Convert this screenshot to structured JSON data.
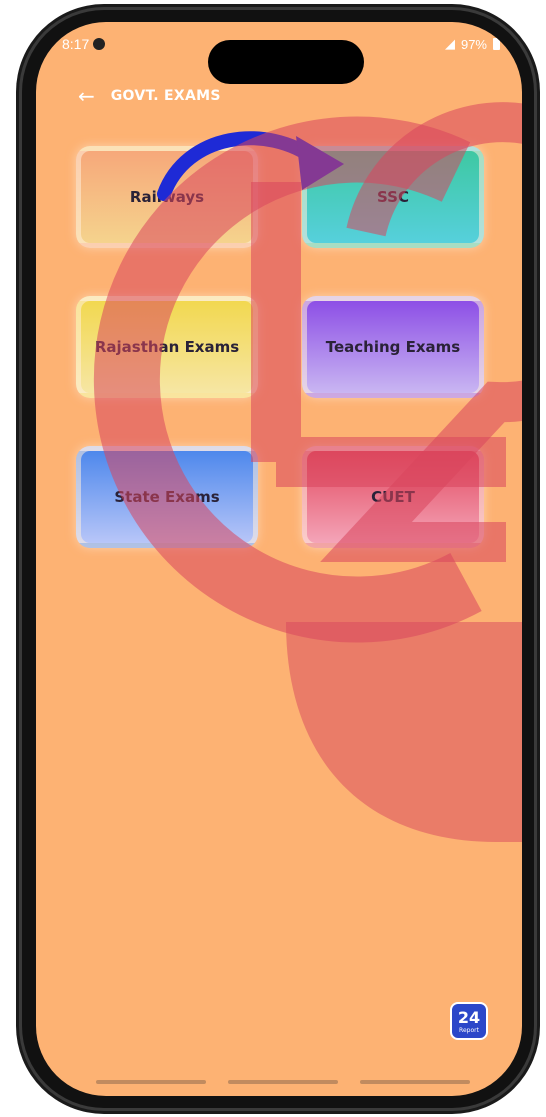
{
  "status_bar": {
    "time": "8:17",
    "battery": "97%"
  },
  "header": {
    "back_icon": "←",
    "title": "GOVT. EXAMS"
  },
  "cards": [
    {
      "label": "Railways"
    },
    {
      "label": "SSC"
    },
    {
      "label": "Rajasthan Exams"
    },
    {
      "label": "Teaching Exams"
    },
    {
      "label": "State Exams"
    },
    {
      "label": "CUET"
    }
  ],
  "badge": {
    "number": "24",
    "sub": "Report"
  },
  "colors": {
    "screen_bg": "#fdb273",
    "arrow": "#1e2ad6",
    "watermark": "#d8455d"
  }
}
